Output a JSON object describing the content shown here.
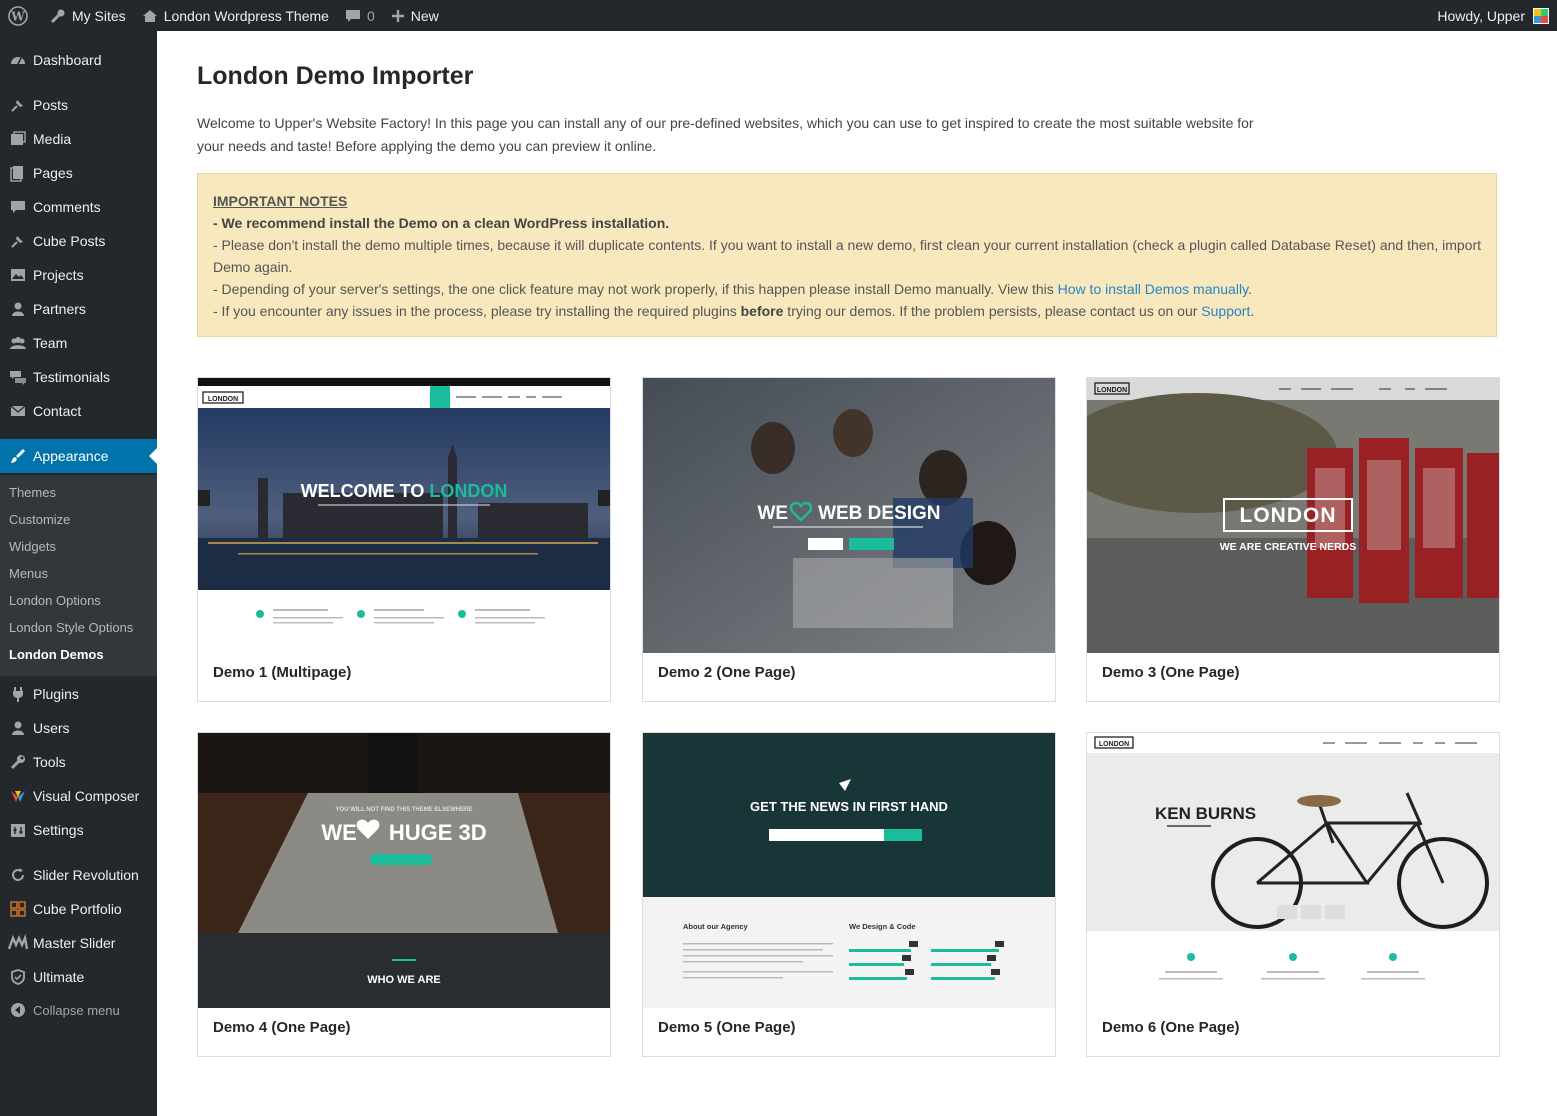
{
  "adminbar": {
    "my_sites": "My Sites",
    "site_name": "London Wordpress Theme",
    "comments_count": "0",
    "new_label": "New",
    "howdy": "Howdy, Upper"
  },
  "sidebar": {
    "items": [
      {
        "label": "Dashboard",
        "icon": "dashboard-icon"
      },
      {
        "label": "Posts",
        "icon": "pin-icon"
      },
      {
        "label": "Media",
        "icon": "media-icon"
      },
      {
        "label": "Pages",
        "icon": "pages-icon"
      },
      {
        "label": "Comments",
        "icon": "comment-icon"
      },
      {
        "label": "Cube Posts",
        "icon": "pin-icon"
      },
      {
        "label": "Projects",
        "icon": "image-icon"
      },
      {
        "label": "Partners",
        "icon": "person-icon"
      },
      {
        "label": "Team",
        "icon": "group-icon"
      },
      {
        "label": "Testimonials",
        "icon": "testimonial-icon"
      },
      {
        "label": "Contact",
        "icon": "mail-icon"
      },
      {
        "label": "Appearance",
        "icon": "brush-icon"
      },
      {
        "label": "Plugins",
        "icon": "plug-icon"
      },
      {
        "label": "Users",
        "icon": "user-icon"
      },
      {
        "label": "Tools",
        "icon": "wrench-icon"
      },
      {
        "label": "Visual Composer",
        "icon": "vc-icon"
      },
      {
        "label": "Settings",
        "icon": "settings-icon"
      },
      {
        "label": "Slider Revolution",
        "icon": "refresh-icon"
      },
      {
        "label": "Cube Portfolio",
        "icon": "grid-icon"
      },
      {
        "label": "Master Slider",
        "icon": "ms-icon"
      },
      {
        "label": "Ultimate",
        "icon": "shield-icon"
      }
    ],
    "submenu": [
      "Themes",
      "Customize",
      "Widgets",
      "Menus",
      "London Options",
      "London Style Options",
      "London Demos"
    ],
    "collapse": "Collapse menu"
  },
  "main": {
    "title": "London Demo Importer",
    "intro": "Welcome to Upper's Website Factory! In this page you can install any of our pre-defined websites, which you can use to get inspired to create the most suitable website for your needs and taste! Before applying the demo you can preview it online.",
    "notes": {
      "title": "IMPORTANT NOTES",
      "line1": "- We recommend install the Demo on a clean WordPress installation.",
      "line2": "- Please don't install the demo multiple times, because it will duplicate contents. If you want to install a new demo, first clean your current installation (check a plugin called Database Reset) and then, import Demo again.",
      "line3_pre": "- Depending of your server's settings, the one click feature may not work properly, if this happen please install Demo manually. View this ",
      "line3_link": "How to install Demos manually",
      "line3_post": ".",
      "line4_pre": "- If you encounter any issues in the process, please try installing the required plugins ",
      "line4_bold": "before",
      "line4_mid": " trying our demos. If the problem persists, please contact us on our ",
      "line4_link": "Support",
      "line4_post": "."
    },
    "demos": [
      {
        "caption": "Demo 1 (Multipage)",
        "headline_a": "WELCOME TO ",
        "headline_b": "LONDON",
        "logo": "LONDON"
      },
      {
        "caption": "Demo 2 (One Page)",
        "headline_a": "WE",
        "headline_b": "WEB DESIGN"
      },
      {
        "caption": "Demo 3 (One Page)",
        "headline_a": "LONDON",
        "headline_b": "WE ARE CREATIVE NERDS",
        "logo": "LONDON"
      },
      {
        "caption": "Demo 4 (One Page)",
        "headline_a": "WE",
        "headline_b": "HUGE 3D",
        "sub": "WHO WE ARE"
      },
      {
        "caption": "Demo 5 (One Page)",
        "headline_a": "GET THE NEWS IN FIRST HAND",
        "about": "About our Agency",
        "design": "We Design & Code"
      },
      {
        "caption": "Demo 6 (One Page)",
        "headline_a": "KEN BURNS",
        "logo": "LONDON"
      }
    ]
  },
  "colors": {
    "adminbar": "#23282d",
    "active": "#0073aa",
    "notice_bg": "#f7e9bd",
    "link": "#2a83c9",
    "accent": "#1abc9c"
  }
}
